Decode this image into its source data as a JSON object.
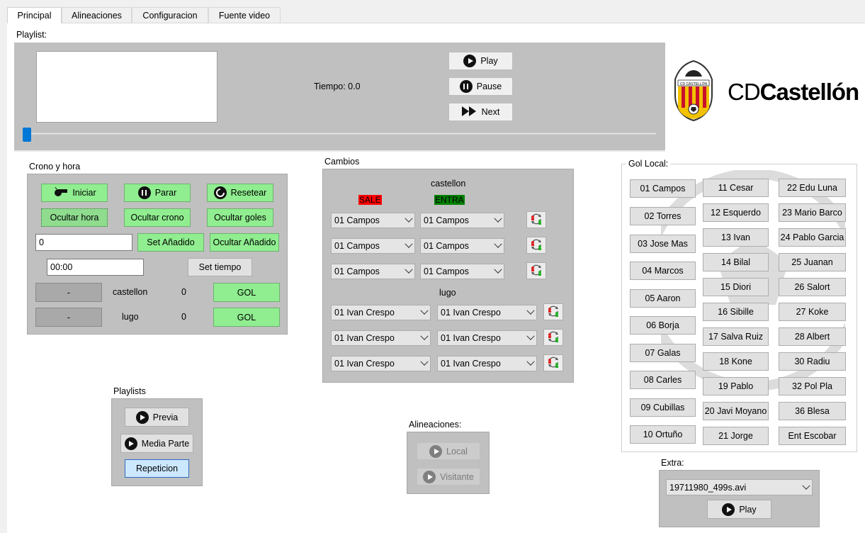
{
  "tabs": [
    "Principal",
    "Alineaciones",
    "Configuracion",
    "Fuente video"
  ],
  "playlist": {
    "label": "Playlist:",
    "tiempo": "Tiempo: 0.0",
    "play": "Play",
    "pause": "Pause",
    "next": "Next",
    "slider_progress": 0
  },
  "logo": {
    "text_cd": "CD",
    "text_name": "Castellón",
    "crest_text": "CD CASTELLÓN"
  },
  "crono": {
    "label": "Crono y hora",
    "iniciar": "Iniciar",
    "parar": "Parar",
    "resetear": "Resetear",
    "ocultar_hora": "Ocultar hora",
    "ocultar_crono": "Ocultar crono",
    "ocultar_goles": "Ocultar goles",
    "anadido_value": "0",
    "set_anadido": "Set Añadido",
    "ocultar_anadido": "Ocultar Añadido",
    "tiempo_value": "00:00",
    "set_tiempo": "Set tiempo",
    "team1": "castellon",
    "score1": "0",
    "team2": "lugo",
    "score2": "0",
    "minus": "-",
    "gol": "GOL"
  },
  "cambios": {
    "label": "Cambios",
    "team1": "castellon",
    "team2": "lugo",
    "sale": "SALE",
    "entra": "ENTRA",
    "team1_rows": [
      [
        "01 Campos",
        "01 Campos"
      ],
      [
        "01 Campos",
        "01 Campos"
      ],
      [
        "01 Campos",
        "01 Campos"
      ]
    ],
    "team2_rows": [
      [
        "01 Ivan Crespo",
        "01 Ivan Crespo"
      ],
      [
        "01 Ivan Crespo",
        "01 Ivan Crespo"
      ],
      [
        "01 Ivan Crespo",
        "01 Ivan Crespo"
      ]
    ]
  },
  "playlists": {
    "label": "Playlists",
    "previa": "Previa",
    "media_parte": "Media Parte",
    "repeticion": "Repeticion"
  },
  "alineaciones": {
    "label": "Alineaciones:",
    "local": "Local",
    "visitante": "Visitante"
  },
  "gol_local": {
    "label": "Gol Local:",
    "col1": [
      "01 Campos",
      "02 Torres",
      "03 Jose Mas",
      "04 Marcos",
      "05 Aaron",
      "06 Borja",
      "07 Galas",
      "08 Carles",
      "09 Cubillas",
      "10 Ortuño"
    ],
    "col2": [
      "11 Cesar",
      "12 Esquerdo",
      "13 Ivan",
      "14 Bilal",
      "15 Diori",
      "16 Sibille",
      "17 Salva Ruiz",
      "18 Kone",
      "19 Pablo",
      "20 Javi Moyano",
      "21 Jorge"
    ],
    "col3": [
      "22 Edu Luna",
      "23 Mario Barco",
      "24 Pablo Garcia",
      "25 Juanan",
      "26 Salort",
      "27 Koke",
      "28 Albert",
      "30 Radiu",
      "32 Pol Pla",
      "36 Blesa",
      "Ent Escobar"
    ]
  },
  "extra": {
    "label": "Extra:",
    "file": "19711980_499s.avi",
    "play": "Play"
  },
  "colors": {
    "green": "#90ee90",
    "sale_bg": "#ff0000",
    "entra_bg": "#008000",
    "panel_grey": "#c0c0c0",
    "blue_btn": "#cce8ff"
  }
}
